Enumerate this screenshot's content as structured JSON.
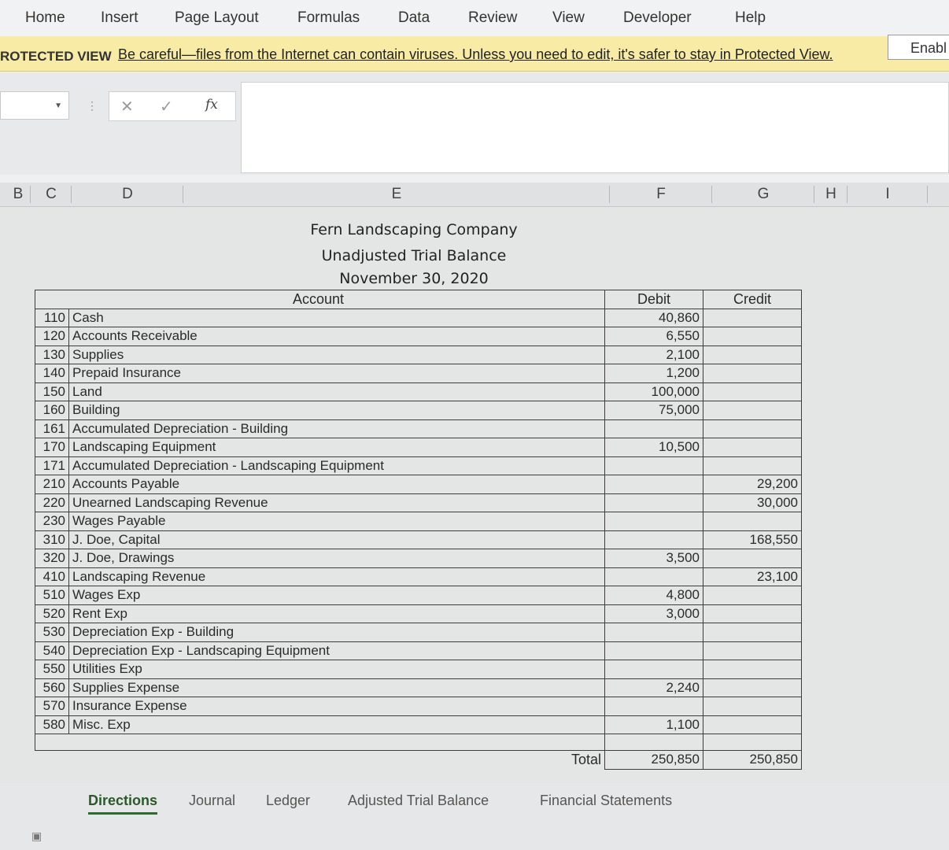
{
  "ribbon": {
    "tabs": [
      "Home",
      "Insert",
      "Page Layout",
      "Formulas",
      "Data",
      "Review",
      "View",
      "Developer",
      "Help"
    ]
  },
  "protected_view": {
    "label": "ROTECTED VIEW",
    "message": "Be careful—files from the Internet can contain viruses. Unless you need to edit, it's safer to stay in Protected View.",
    "button": "Enabl"
  },
  "formula_bar": {
    "cancel_glyph": "✕",
    "enter_glyph": "✓",
    "fx_glyph": "fx"
  },
  "columns": [
    "B",
    "C",
    "D",
    "E",
    "F",
    "G",
    "H",
    "I"
  ],
  "report": {
    "company": "Fern Landscaping Company",
    "title": "Unadjusted Trial Balance",
    "date": "November 30, 2020",
    "header_account": "Account",
    "header_debit": "Debit",
    "header_credit": "Credit",
    "total_label": "Total",
    "total_debit": "250,850",
    "total_credit": "250,850"
  },
  "accounts": [
    {
      "code": "110",
      "name": "Cash",
      "debit": "40,860",
      "credit": ""
    },
    {
      "code": "120",
      "name": "Accounts Receivable",
      "debit": "6,550",
      "credit": ""
    },
    {
      "code": "130",
      "name": "Supplies",
      "debit": "2,100",
      "credit": ""
    },
    {
      "code": "140",
      "name": "Prepaid Insurance",
      "debit": "1,200",
      "credit": ""
    },
    {
      "code": "150",
      "name": "Land",
      "debit": "100,000",
      "credit": ""
    },
    {
      "code": "160",
      "name": "Building",
      "debit": "75,000",
      "credit": ""
    },
    {
      "code": "161",
      "name": "Accumulated Depreciation - Building",
      "debit": "",
      "credit": ""
    },
    {
      "code": "170",
      "name": "Landscaping Equipment",
      "debit": "10,500",
      "credit": ""
    },
    {
      "code": "171",
      "name": "Accumulated Depreciation - Landscaping Equipment",
      "debit": "",
      "credit": ""
    },
    {
      "code": "210",
      "name": "Accounts Payable",
      "debit": "",
      "credit": "29,200"
    },
    {
      "code": "220",
      "name": "Unearned Landscaping Revenue",
      "debit": "",
      "credit": "30,000"
    },
    {
      "code": "230",
      "name": "Wages Payable",
      "debit": "",
      "credit": ""
    },
    {
      "code": "310",
      "name": "J. Doe, Capital",
      "debit": "",
      "credit": "168,550"
    },
    {
      "code": "320",
      "name": "J. Doe, Drawings",
      "debit": "3,500",
      "credit": ""
    },
    {
      "code": "410",
      "name": "Landscaping Revenue",
      "debit": "",
      "credit": "23,100"
    },
    {
      "code": "510",
      "name": "Wages Exp",
      "debit": "4,800",
      "credit": ""
    },
    {
      "code": "520",
      "name": "Rent Exp",
      "debit": "3,000",
      "credit": ""
    },
    {
      "code": "530",
      "name": "Depreciation Exp - Building",
      "debit": "",
      "credit": ""
    },
    {
      "code": "540",
      "name": "Depreciation Exp - Landscaping Equipment",
      "debit": "",
      "credit": ""
    },
    {
      "code": "550",
      "name": "Utilities Exp",
      "debit": "",
      "credit": ""
    },
    {
      "code": "560",
      "name": "Supplies Expense",
      "debit": "2,240",
      "credit": ""
    },
    {
      "code": "570",
      "name": "Insurance Expense",
      "debit": "",
      "credit": ""
    },
    {
      "code": "580",
      "name": "Misc. Exp",
      "debit": "1,100",
      "credit": ""
    }
  ],
  "sheet_tabs": [
    "Directions",
    "Journal",
    "Ledger",
    "Adjusted Trial Balance",
    "Financial Statements"
  ],
  "active_tab": "Directions"
}
